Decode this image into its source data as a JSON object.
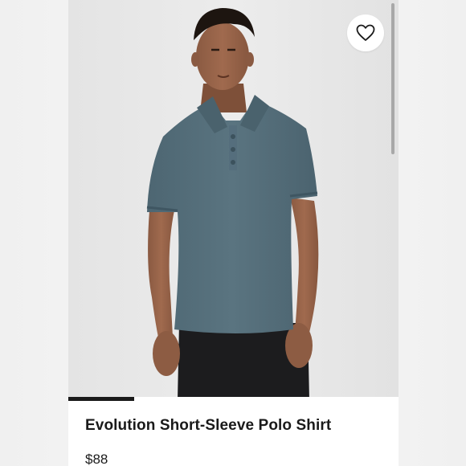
{
  "product": {
    "name": "Evolution Short-Sleeve Polo Shirt",
    "price": "$88",
    "image_alt": "Model wearing a slate blue short-sleeve polo shirt and black shorts",
    "shirt_color": "#56707c",
    "shorts_color": "#1c1c1e"
  },
  "favorite": {
    "icon": "heart-outline-icon",
    "active": false
  },
  "gallery": {
    "progress_fraction": 0.2
  },
  "colors": {
    "background": "#e6e6e6",
    "text": "#1a1a1a",
    "indicator": "#1a1a1a"
  }
}
